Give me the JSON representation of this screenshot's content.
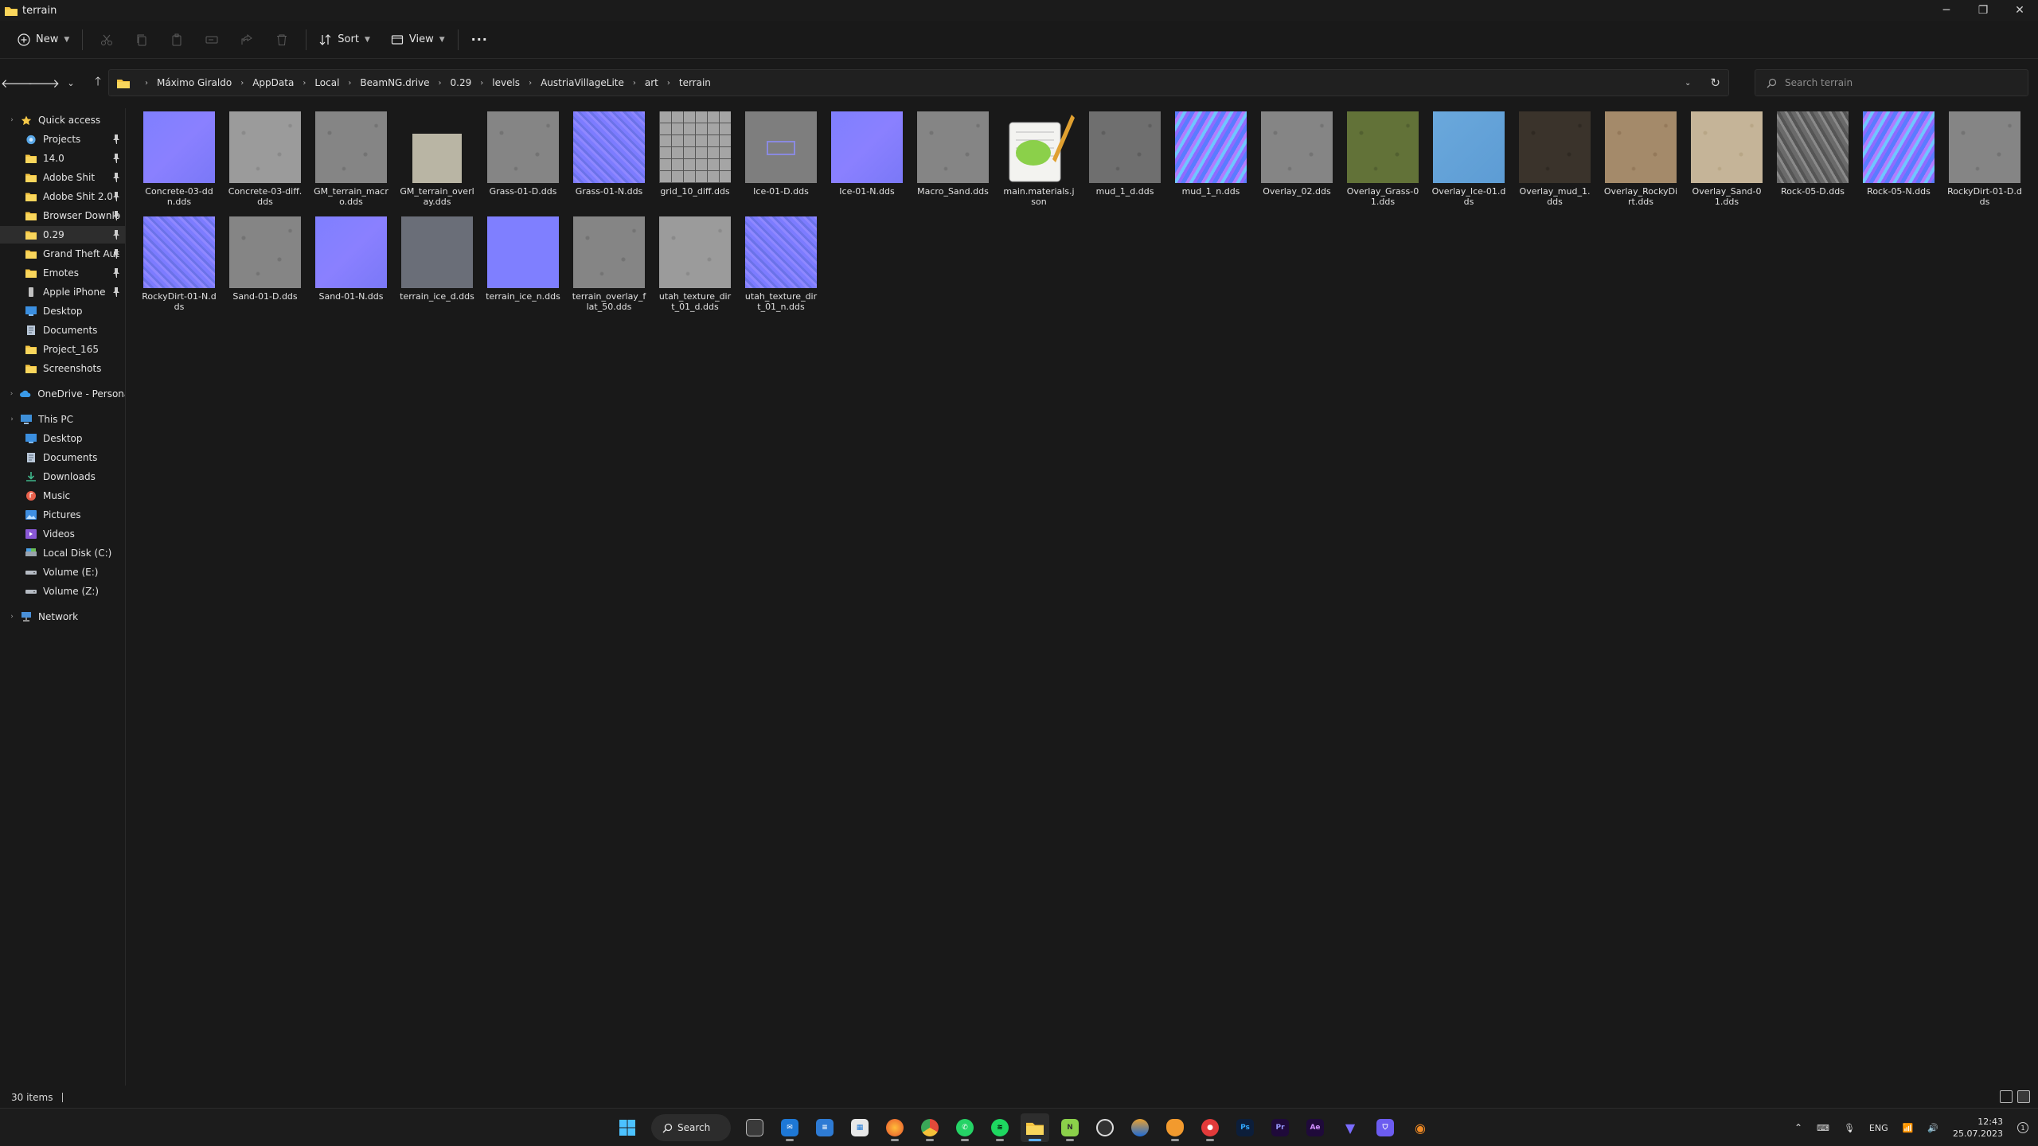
{
  "window": {
    "title": "terrain",
    "controls": {
      "minimize": "─",
      "maximize": "❐",
      "close": "✕"
    }
  },
  "toolbar": {
    "new_label": "New",
    "sort_label": "Sort",
    "view_label": "View",
    "more_label": "···"
  },
  "address": {
    "crumbs": [
      "Máximo Giraldo",
      "AppData",
      "Local",
      "BeamNG.drive",
      "0.29",
      "levels",
      "AustriaVillageLite",
      "art",
      "terrain"
    ]
  },
  "search": {
    "placeholder": "Search terrain"
  },
  "sidebar": {
    "quick_access": "Quick access",
    "pinned": [
      "Projects",
      "14.0",
      "Adobe Shit",
      "Adobe Shit 2.0",
      "Browser Downlo",
      "0.29",
      "Grand Theft Aut",
      "Emotes",
      "Apple iPhone"
    ],
    "recent": [
      "Desktop",
      "Documents",
      "Project_165",
      "Screenshots"
    ],
    "onedrive": "OneDrive - Personal",
    "this_pc": "This PC",
    "pc_items": [
      "Desktop",
      "Documents",
      "Downloads",
      "Music",
      "Pictures",
      "Videos",
      "Local Disk (C:)",
      "Volume (E:)",
      "Volume (Z:)"
    ],
    "network": "Network"
  },
  "files": [
    {
      "name": "Concrete-03-ddn.dds",
      "thumb": "normal-flat"
    },
    {
      "name": "Concrete-03-diff.dds",
      "thumb": "gray-light"
    },
    {
      "name": "GM_terrain_macro.dds",
      "thumb": "gray"
    },
    {
      "name": "GM_terrain_overlay.dds",
      "thumb": "small-beige"
    },
    {
      "name": "Grass-01-D.dds",
      "thumb": "gray"
    },
    {
      "name": "Grass-01-N.dds",
      "thumb": "normal-noisy"
    },
    {
      "name": "grid_10_diff.dds",
      "thumb": "grid"
    },
    {
      "name": "Ice-01-D.dds",
      "thumb": "ice-gray"
    },
    {
      "name": "Ice-01-N.dds",
      "thumb": "normal-flat"
    },
    {
      "name": "Macro_Sand.dds",
      "thumb": "gray"
    },
    {
      "name": "main.materials.json",
      "thumb": "notepad"
    },
    {
      "name": "mud_1_d.dds",
      "thumb": "gray-dark"
    },
    {
      "name": "mud_1_n.dds",
      "thumb": "normal-bright"
    },
    {
      "name": "Overlay_02.dds",
      "thumb": "gray"
    },
    {
      "name": "Overlay_Grass-01.dds",
      "thumb": "grass"
    },
    {
      "name": "Overlay_Ice-01.dds",
      "thumb": "ice-blue"
    },
    {
      "name": "Overlay_mud_1.dds",
      "thumb": "mud"
    },
    {
      "name": "Overlay_RockyDirt.dds",
      "thumb": "sand-dark"
    },
    {
      "name": "Overlay_Sand-01.dds",
      "thumb": "sand-light"
    },
    {
      "name": "Rock-05-D.dds",
      "thumb": "rock"
    },
    {
      "name": "Rock-05-N.dds",
      "thumb": "normal-bright"
    },
    {
      "name": "RockyDirt-01-D.dds",
      "thumb": "gray"
    },
    {
      "name": "RockyDirt-01-N.dds",
      "thumb": "normal-noisy"
    },
    {
      "name": "Sand-01-D.dds",
      "thumb": "gray"
    },
    {
      "name": "Sand-01-N.dds",
      "thumb": "normal-flat"
    },
    {
      "name": "terrain_ice_d.dds",
      "thumb": "slate"
    },
    {
      "name": "terrain_ice_n.dds",
      "thumb": "normal-solid"
    },
    {
      "name": "terrain_overlay_flat_50.dds",
      "thumb": "gray"
    },
    {
      "name": "utah_texture_dirt_01_d.dds",
      "thumb": "gray-light"
    },
    {
      "name": "utah_texture_dirt_01_n.dds",
      "thumb": "normal-noisy"
    }
  ],
  "status": {
    "item_count": "30 items"
  },
  "taskbar": {
    "search_label": "Search",
    "apps": [
      "start-icon",
      "task-view-icon",
      "mail-icon",
      "notepad-icon",
      "store-icon",
      "firefox-icon",
      "chrome-icon",
      "whatsapp-icon",
      "spotify-icon",
      "file-explorer-icon",
      "notepadpp-icon",
      "obs-icon",
      "media-icon",
      "fl-studio-icon",
      "recorder-icon",
      "photoshop-icon",
      "premiere-icon",
      "after-effects-icon",
      "vpn-icon",
      "shield-icon",
      "blender-icon"
    ],
    "app_labels": {
      "photoshop": "Ps",
      "premiere": "Pr",
      "after_effects": "Ae"
    },
    "language": "ENG",
    "time": "12:43",
    "date": "25.07.2023"
  }
}
